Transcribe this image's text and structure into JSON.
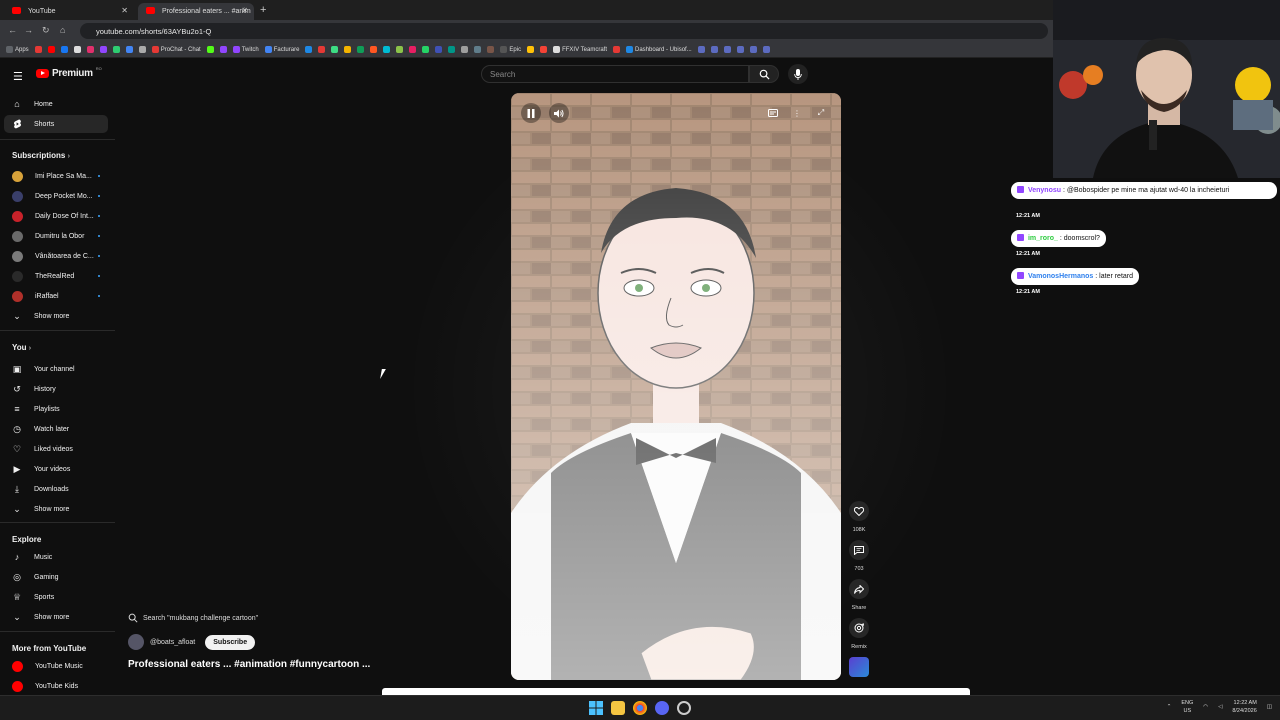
{
  "browser": {
    "tabs": [
      {
        "title": "YouTube"
      },
      {
        "title": "Professional eaters ... #anim"
      }
    ],
    "url": "youtube.com/shorts/63AYBu2o1-Q",
    "bookmarks": [
      "Apps",
      "ProChat - Chat",
      "Twitch",
      "Facturare",
      "Epic",
      "FFXIV Teamcraft",
      "Dashboard - Ubisof..."
    ]
  },
  "youtube": {
    "logo_text": "Premium",
    "logo_sup": "RO",
    "search_placeholder": "Search",
    "sidebar": {
      "main": [
        {
          "label": "Home",
          "icon": "home-icon"
        },
        {
          "label": "Shorts",
          "icon": "shorts-icon",
          "active": true
        }
      ],
      "subscriptions_header": "Subscriptions",
      "subscriptions": [
        {
          "label": "Imi Place Sa Ma...",
          "color": "#d8a23a"
        },
        {
          "label": "Deep Pocket Mo...",
          "color": "#3a3f6a"
        },
        {
          "label": "Daily Dose Of Int...",
          "color": "#c8222a"
        },
        {
          "label": "Dumitru la Obor",
          "color": "#6a6a6a"
        },
        {
          "label": "Vânătoarea de C...",
          "color": "#7a7a7a"
        },
        {
          "label": "TheRealRed",
          "color": "#2a2a2a"
        },
        {
          "label": "iRaffael",
          "color": "#b0302a"
        }
      ],
      "show_more_1": "Show more",
      "you_header": "You",
      "you": [
        {
          "label": "Your channel",
          "icon": "channel-icon"
        },
        {
          "label": "History",
          "icon": "history-icon"
        },
        {
          "label": "Playlists",
          "icon": "playlist-icon"
        },
        {
          "label": "Watch later",
          "icon": "clock-icon"
        },
        {
          "label": "Liked videos",
          "icon": "like-icon"
        },
        {
          "label": "Your videos",
          "icon": "video-icon"
        },
        {
          "label": "Downloads",
          "icon": "download-icon"
        }
      ],
      "show_more_2": "Show more",
      "explore_header": "Explore",
      "explore": [
        {
          "label": "Music",
          "icon": "music-icon"
        },
        {
          "label": "Gaming",
          "icon": "gaming-icon"
        },
        {
          "label": "Sports",
          "icon": "trophy-icon"
        }
      ],
      "show_more_3": "Show more",
      "more_header": "More from YouTube",
      "more": [
        {
          "label": "YouTube Music"
        },
        {
          "label": "YouTube Kids"
        }
      ]
    },
    "short": {
      "search_suggestion": "Search \"mukbang challenge cartoon\"",
      "channel": "@boats_afloat",
      "subscribe": "Subscribe",
      "title": "Professional eaters ... #animation #funnycartoon ...",
      "likes": "108K",
      "comments": "703",
      "share": "Share",
      "remix": "Remix"
    }
  },
  "chat": [
    {
      "user": "Venynosu",
      "user_color": "#9146ff",
      "message": "@Bobospider pe mine ma ajutat wd-40 la incheieturi",
      "time": "12:21 AM"
    },
    {
      "user": "im_roro_",
      "user_color": "#2ecc40",
      "message": "doomscrol?",
      "time": "12:21 AM"
    },
    {
      "user": "VamonosHermanos",
      "user_color": "#2f80ed",
      "message": "later retard",
      "time": "12:21 AM"
    }
  ],
  "taskbar": {
    "lang": "ENG",
    "region": "US",
    "time": "12:22 AM",
    "date": "8/24/2026"
  }
}
